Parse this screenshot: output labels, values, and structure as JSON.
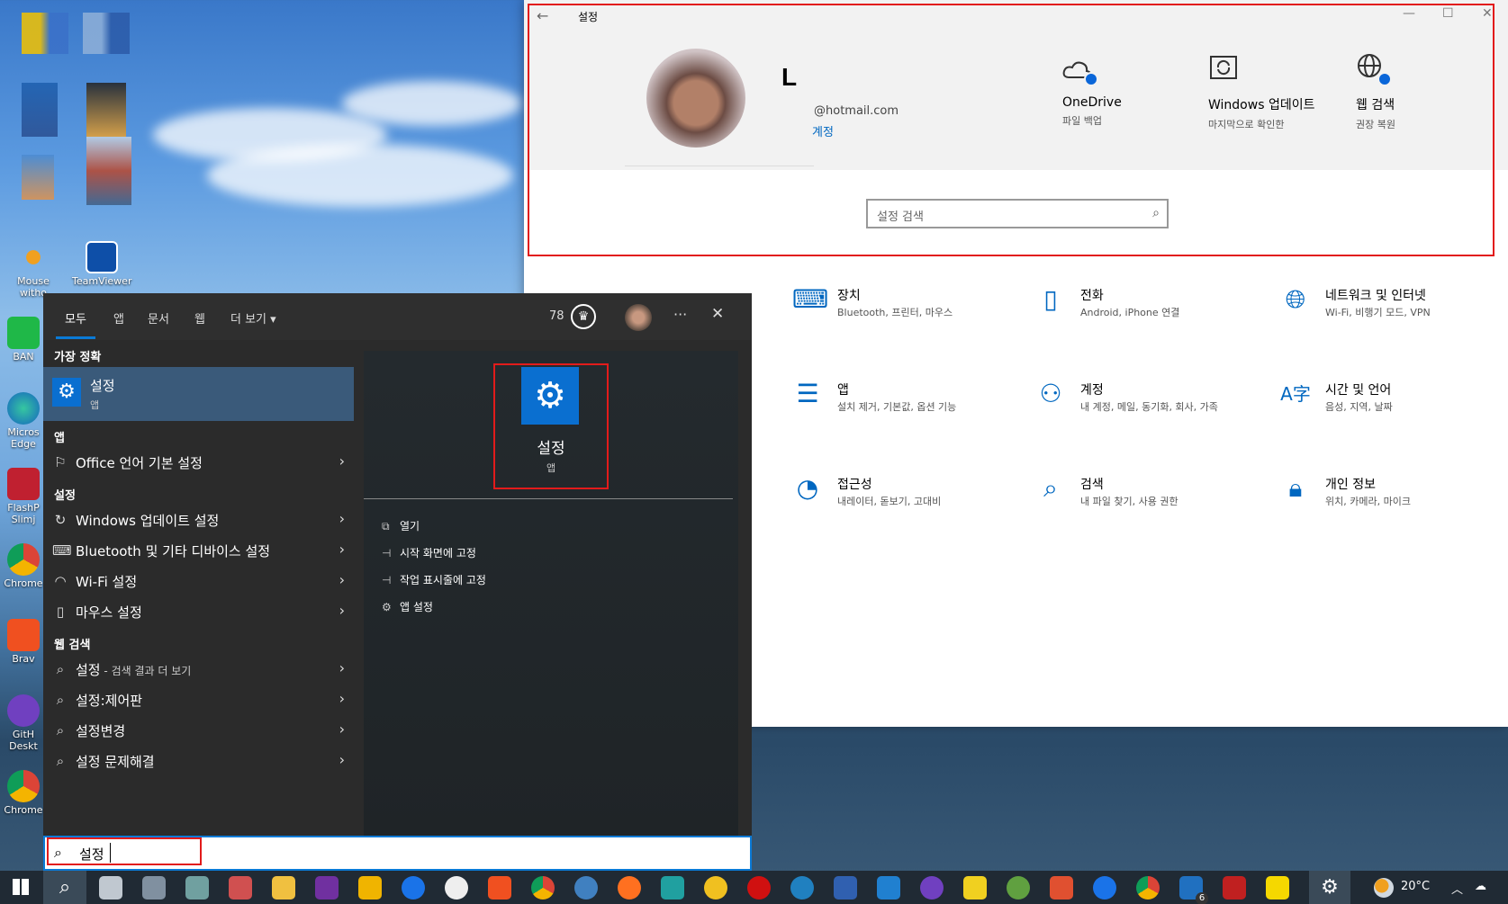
{
  "desktop": {
    "icons": [
      {
        "label": "Mouse witho"
      },
      {
        "label": "TeamViewer"
      },
      {
        "label": "BAN"
      },
      {
        "label": "Micros Edge"
      },
      {
        "label": "FlashP Slimj"
      },
      {
        "label": "Chrome"
      },
      {
        "label": "Brav"
      },
      {
        "label": "GitH Deskt"
      },
      {
        "label": "Chrome"
      }
    ]
  },
  "settings_window": {
    "title": "설정",
    "user": {
      "name": "L",
      "email": "@hotmail.com",
      "account_link": "계정"
    },
    "quick_actions": [
      {
        "title": "OneDrive",
        "subtitle": "파일 백업",
        "icon": "cloud-icon"
      },
      {
        "title": "Windows 업데이트",
        "subtitle": "마지막으로 확인한",
        "icon": "sync-icon"
      },
      {
        "title": "웹 검색",
        "subtitle": "권장 복원",
        "icon": "globe-icon"
      }
    ],
    "search_placeholder": "설정 검색",
    "categories": [
      {
        "title": "장치",
        "subtitle": "Bluetooth, 프린터, 마우스",
        "icon": "devices-icon"
      },
      {
        "title": "전화",
        "subtitle": "Android, iPhone 연결",
        "icon": "phone-icon"
      },
      {
        "title": "네트워크 및 인터넷",
        "subtitle": "Wi-Fi, 비행기 모드, VPN",
        "icon": "globe-icon"
      },
      {
        "title": "앱",
        "subtitle": "설치 제거, 기본값, 옵션 기능",
        "icon": "apps-icon"
      },
      {
        "title": "계정",
        "subtitle": "내 계정, 메일, 동기화, 회사, 가족",
        "icon": "person-icon"
      },
      {
        "title": "시간 및 언어",
        "subtitle": "음성, 지역, 날짜",
        "icon": "language-icon"
      },
      {
        "title": "접근성",
        "subtitle": "내레이터, 돋보기, 고대비",
        "icon": "accessibility-icon"
      },
      {
        "title": "검색",
        "subtitle": "내 파일 찾기, 사용 권한",
        "icon": "search-icon"
      },
      {
        "title": "개인 정보",
        "subtitle": "위치, 카메라, 마이크",
        "icon": "lock-icon"
      }
    ]
  },
  "start_menu": {
    "tabs": [
      "모두",
      "앱",
      "문서",
      "웹",
      "더 보기"
    ],
    "points": "78",
    "best_match_header": "가장 정확",
    "best_match": {
      "title": "설정",
      "subtitle": "앱"
    },
    "apps_header": "앱",
    "apps": [
      {
        "label": "Office 언어 기본 설정"
      }
    ],
    "settings_header": "설정",
    "settings": [
      {
        "label": "Windows 업데이트 설정"
      },
      {
        "label": "Bluetooth 및 기타 디바이스 설정"
      },
      {
        "label": "Wi-Fi 설정"
      },
      {
        "label": "마우스 설정"
      }
    ],
    "web_header": "웹 검색",
    "web": [
      {
        "label": "설정",
        "suffix": " - 검색 결과 더 보기"
      },
      {
        "label": "설정:제어판",
        "suffix": ""
      },
      {
        "label": "설정변경",
        "suffix": ""
      },
      {
        "label": "설정 문제해결",
        "suffix": ""
      }
    ],
    "preview": {
      "title": "설정",
      "subtitle": "앱"
    },
    "actions": [
      {
        "label": "열기",
        "icon": "open-icon"
      },
      {
        "label": "시작 화면에 고정",
        "icon": "pin-icon"
      },
      {
        "label": "작업 표시줄에 고정",
        "icon": "pin-icon"
      },
      {
        "label": "앱 설정",
        "icon": "gear-icon"
      }
    ],
    "search_value": "설정"
  },
  "taskbar": {
    "temperature": "20°C",
    "badge_count": "6",
    "colors": {
      "accent": "#0a7ad6",
      "highlight": "#e21b1b"
    }
  }
}
